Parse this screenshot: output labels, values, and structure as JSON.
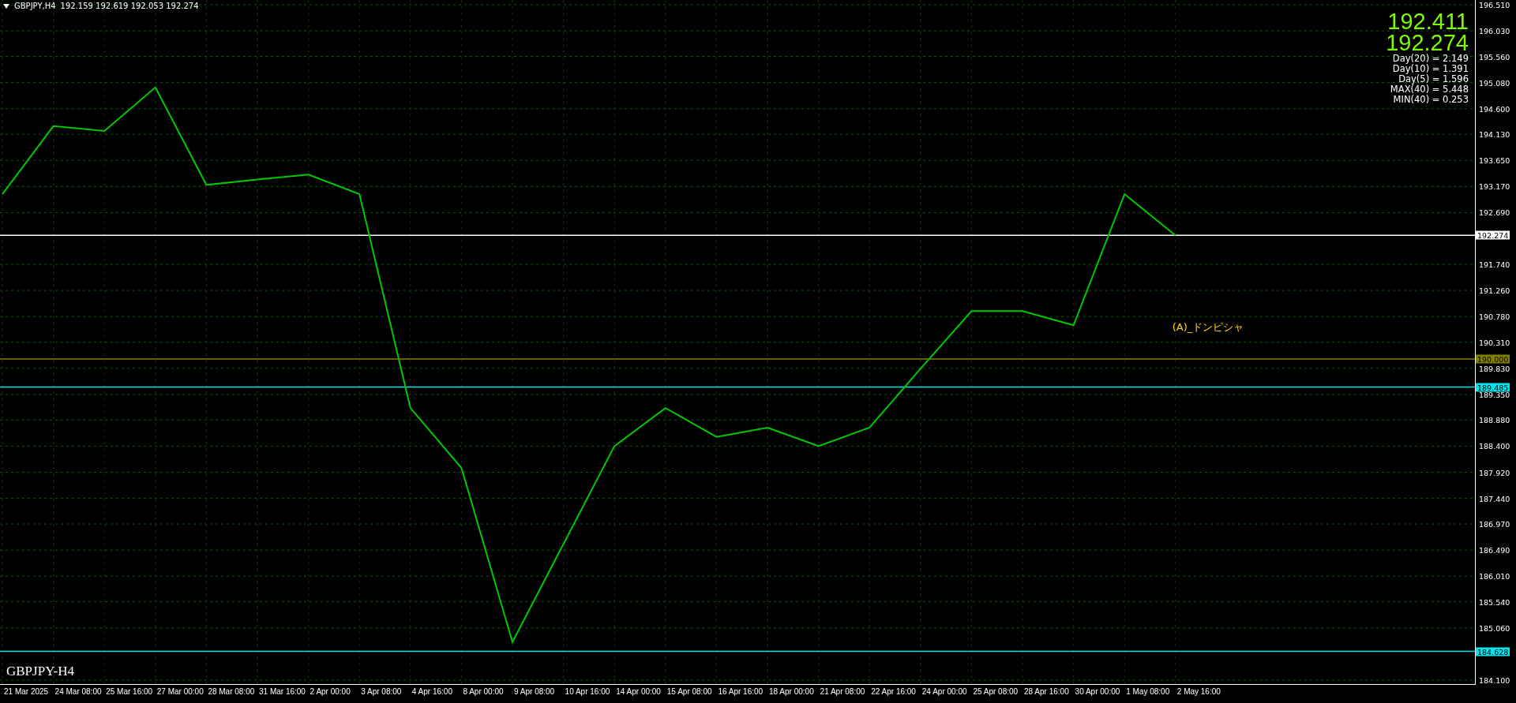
{
  "header": {
    "symbol": "GBPJPY,H4",
    "ohlc": "192.159 192.619 192.053 192.274"
  },
  "quotes": [
    "192.411",
    "192.274"
  ],
  "stats": [
    "Day(20) = 2.149",
    "Day(10) = 1.391",
    "Day(5) = 1.596",
    "MAX(40) = 5.448",
    "MIN(40) = 0.253"
  ],
  "annotation": "(A)_ドンピシャ",
  "chart_label": "GBPJPY-H4",
  "chart_data": {
    "type": "line",
    "ylim": [
      184.1,
      196.51
    ],
    "grid": true,
    "ref_lines": [
      {
        "axis": "y",
        "value": 192.274,
        "label": "192.274",
        "color": "#ffffff"
      },
      {
        "axis": "y",
        "value": 190.0,
        "label": "190.000",
        "color": "#808000"
      },
      {
        "axis": "y",
        "value": 189.485,
        "label": "189.485",
        "color": "#00e5ee"
      },
      {
        "axis": "y",
        "value": 184.628,
        "label": "184.628",
        "color": "#00e5ee"
      }
    ],
    "categories": [
      "21 Mar 2025",
      "24 Mar 08:00",
      "25 Mar 16:00",
      "27 Mar 00:00",
      "28 Mar 08:00",
      "31 Mar 16:00",
      "2 Apr 00:00",
      "3 Apr 08:00",
      "4 Apr 16:00",
      "8 Apr 00:00",
      "9 Apr 08:00",
      "10 Apr 16:00",
      "14 Apr 00:00",
      "15 Apr 08:00",
      "16 Apr 16:00",
      "18 Apr 00:00",
      "21 Apr 08:00",
      "22 Apr 16:00",
      "24 Apr 00:00",
      "25 Apr 08:00",
      "28 Apr 16:00",
      "30 Apr 00:00",
      "1 May 08:00",
      "2 May 16:00"
    ],
    "series": [
      {
        "color": "#00c800",
        "values": [
          193.03,
          194.28,
          194.19,
          194.99,
          193.2,
          193.3,
          193.39,
          193.03,
          189.1,
          188.0,
          184.8,
          186.6,
          188.4,
          189.1,
          188.57,
          188.74,
          188.4,
          188.74,
          189.82,
          190.88,
          190.88,
          190.62,
          193.03,
          192.27
        ]
      }
    ],
    "yticks": [
      {
        "value": 196.51,
        "label": "196.510"
      },
      {
        "value": 196.03,
        "label": "196.030"
      },
      {
        "value": 195.56,
        "label": "195.560"
      },
      {
        "value": 195.08,
        "label": "195.080"
      },
      {
        "value": 194.6,
        "label": "194.600"
      },
      {
        "value": 194.13,
        "label": "194.130"
      },
      {
        "value": 193.65,
        "label": "193.650"
      },
      {
        "value": 193.17,
        "label": "193.170"
      },
      {
        "value": 192.69,
        "label": "192.690"
      },
      {
        "value": 191.74,
        "label": "191.740"
      },
      {
        "value": 191.26,
        "label": "191.260"
      },
      {
        "value": 190.78,
        "label": "190.780"
      },
      {
        "value": 190.31,
        "label": "190.310"
      },
      {
        "value": 189.83,
        "label": "189.830"
      },
      {
        "value": 189.35,
        "label": "189.350"
      },
      {
        "value": 188.88,
        "label": "188.880"
      },
      {
        "value": 188.4,
        "label": "188.400"
      },
      {
        "value": 187.92,
        "label": "187.920"
      },
      {
        "value": 187.44,
        "label": "187.440"
      },
      {
        "value": 186.97,
        "label": "186.970"
      },
      {
        "value": 186.49,
        "label": "186.490"
      },
      {
        "value": 186.01,
        "label": "186.010"
      },
      {
        "value": 185.54,
        "label": "185.540"
      },
      {
        "value": 185.06,
        "label": "185.060"
      },
      {
        "value": 184.1,
        "label": "184.100"
      }
    ]
  }
}
